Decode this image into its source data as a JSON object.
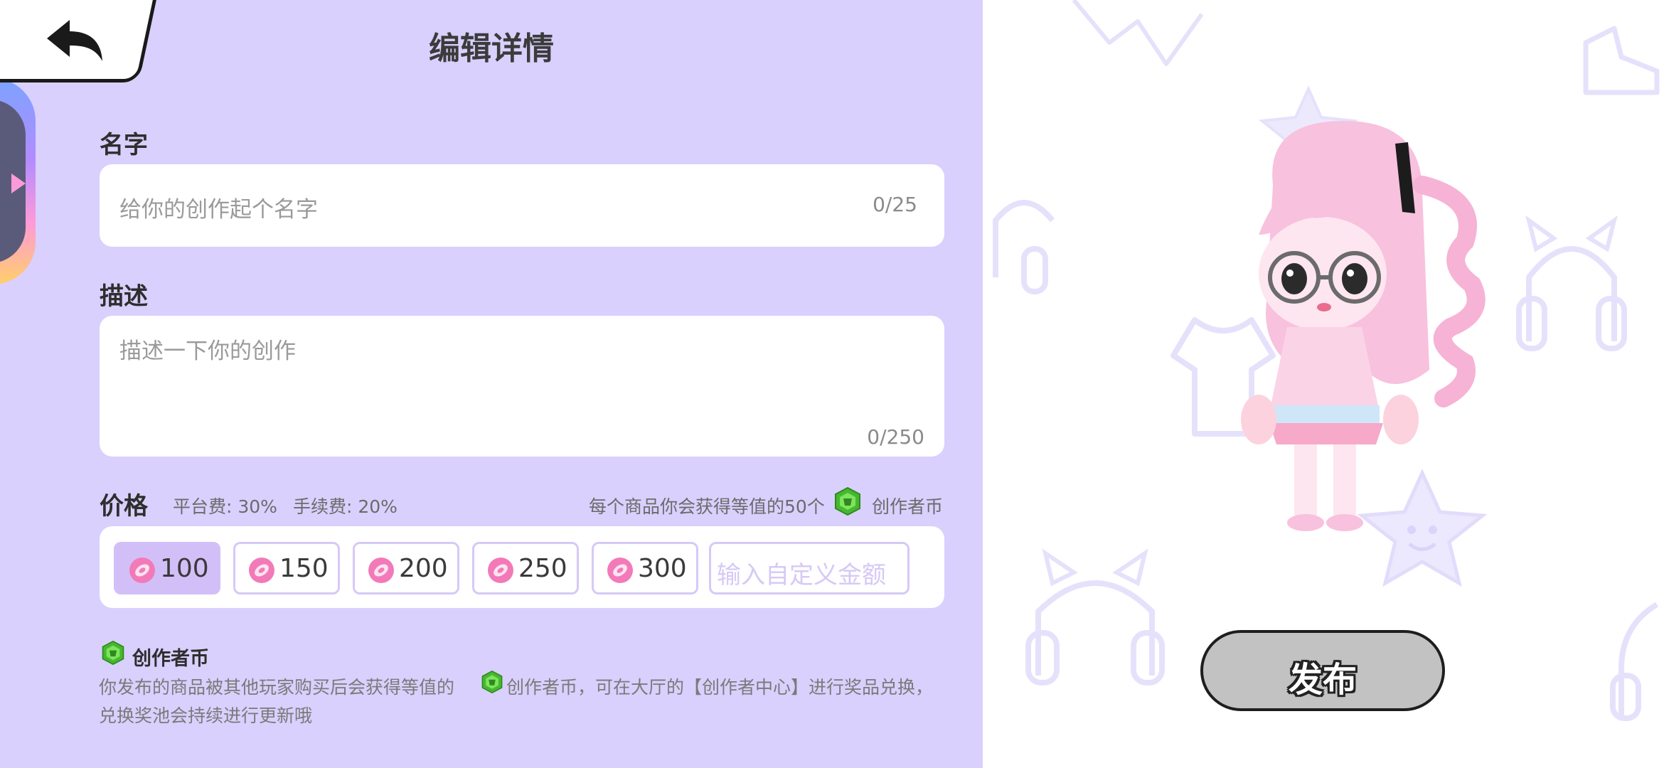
{
  "header": {
    "title": "编辑详情"
  },
  "name_field": {
    "label": "名字",
    "placeholder": "给你的创作起个名字",
    "counter": "0/25"
  },
  "description_field": {
    "label": "描述",
    "placeholder": "描述一下你的创作",
    "counter": "0/250"
  },
  "price": {
    "label": "价格",
    "platform_fee": "平台费: 30%",
    "service_fee": "手续费: 20%",
    "earn_prefix": "每个商品你会获得等值的50个",
    "earn_suffix": "创作者币",
    "options": [
      "100",
      "150",
      "200",
      "250",
      "300"
    ],
    "selected_index": 0,
    "custom_placeholder": "输入自定义金额"
  },
  "creator_coin_info": {
    "title": "创作者币",
    "line1_a": "你发布的商品被其他玩家购买后会获得等值的",
    "line1_b": "创作者币，可在大厅的【创作者中心】进行奖品兑换，",
    "line2": "兑换奖池会持续进行更新哦"
  },
  "publish_button": {
    "label": "发布"
  },
  "colors": {
    "panel_bg": "#d9d0fd",
    "accent": "#d3bff8",
    "gem_green": "#4fc23a",
    "coin_pink": "#f06bb4"
  },
  "icons": {
    "back": "back-arrow-icon",
    "gem": "creator-coin-gem-icon",
    "coin": "pink-coin-icon"
  }
}
